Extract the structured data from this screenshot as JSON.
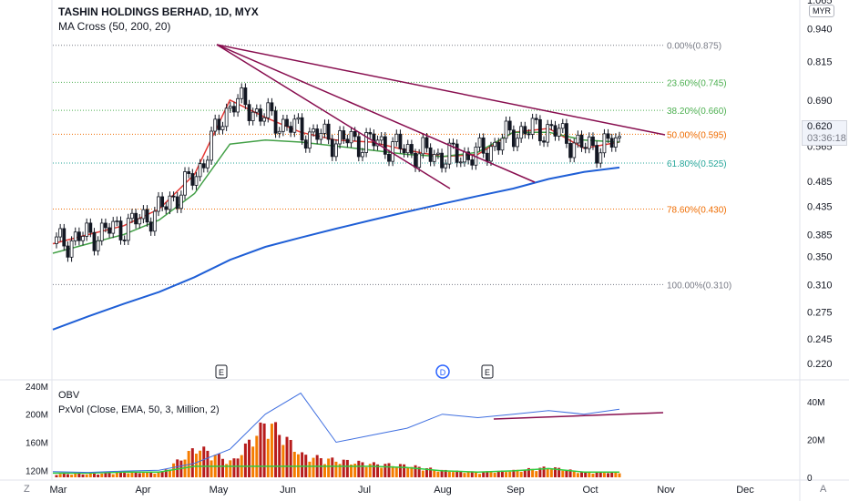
{
  "header": {
    "title": "TASHIN HOLDINGS BERHAD, 1D, MYX",
    "indicator": "MA Cross (50, 200, 20)",
    "currency": "MYR"
  },
  "price_badge": {
    "price": "0.620",
    "countdown": "03:36:18"
  },
  "lower_pane": {
    "obv_label": "OBV",
    "pxvol_label": "PxVol (Close, EMA, 50, 3, Million, 2)"
  },
  "corners": {
    "left": "Z",
    "right": "A"
  },
  "colors": {
    "up": "#ffffff",
    "down": "#131722",
    "ma_short": "#e53935",
    "ma_mid": "#43a047",
    "ma_long": "#1f5fd6",
    "trendline": "#880e4f",
    "obv": "#3f6fe0",
    "vol_up": "#f57c00",
    "vol_down": "#b71c1c",
    "vol_ema": "#2ecc40"
  },
  "chart_data": [
    {
      "type": "candlestick",
      "title": "TASHIN HOLDINGS BERHAD, 1D, MYX",
      "x_ticks": [
        "Mar",
        "Apr",
        "May",
        "Jun",
        "Jul",
        "Aug",
        "Sep",
        "Oct",
        "Nov",
        "Dec"
      ],
      "y_ticks": [
        "1.065",
        "0.940",
        "0.815",
        "0.690",
        "0.620",
        "0.565",
        "0.485",
        "0.435",
        "0.385",
        "0.350",
        "0.310",
        "0.275",
        "0.245",
        "0.220"
      ],
      "y_scale": "log",
      "ylim": [
        0.205,
        1.065
      ],
      "last_price": 0.62,
      "fib_levels": [
        {
          "label": "0.00%(0.875)",
          "value": 0.875
        },
        {
          "label": "23.60%(0.745)",
          "value": 0.745
        },
        {
          "label": "38.20%(0.660)",
          "value": 0.66
        },
        {
          "label": "50.00%(0.595)",
          "value": 0.595
        },
        {
          "label": "61.80%(0.525)",
          "value": 0.525
        },
        {
          "label": "78.60%(0.430)",
          "value": 0.43
        },
        {
          "label": "100.00%(0.310)",
          "value": 0.31
        }
      ],
      "events": [
        "E",
        "D",
        "E"
      ],
      "ma_series": [
        {
          "name": "MA 20",
          "values": [
            0.37,
            0.385,
            0.4,
            0.43,
            0.5,
            0.69,
            0.64,
            0.6,
            0.58,
            0.575,
            0.555,
            0.54,
            0.545,
            0.6,
            0.61,
            0.56,
            0.575
          ]
        },
        {
          "name": "MA 50",
          "values": [
            0.355,
            0.37,
            0.385,
            0.41,
            0.46,
            0.57,
            0.58,
            0.575,
            0.565,
            0.555,
            0.545,
            0.54,
            0.55,
            0.6,
            0.6,
            0.58,
            0.575
          ]
        },
        {
          "name": "MA 200",
          "values": [
            0.255,
            0.27,
            0.285,
            0.3,
            0.32,
            0.345,
            0.365,
            0.38,
            0.395,
            0.41,
            0.425,
            0.44,
            0.455,
            0.47,
            0.49,
            0.505,
            0.515
          ]
        }
      ]
    },
    {
      "type": "bar",
      "title": "OBV / PxVol",
      "left_y_ticks": [
        "240M",
        "200M",
        "160M",
        "120M"
      ],
      "right_y_ticks": [
        "40M",
        "20M",
        "0"
      ],
      "obv_values": [
        118,
        117,
        119,
        120,
        130,
        150,
        200,
        230,
        160,
        170,
        180,
        200,
        195,
        200,
        205,
        200,
        207
      ],
      "pxvol_values": [
        2,
        2,
        3,
        3,
        18,
        9,
        34,
        13,
        10,
        8,
        7,
        4,
        3,
        4,
        6,
        3,
        3
      ]
    }
  ]
}
